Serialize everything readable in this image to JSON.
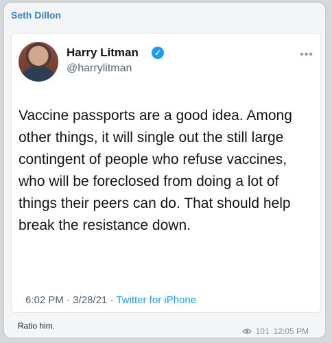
{
  "message": {
    "sender_name": "Seth Dillon",
    "caption": "Ratio him.",
    "views": "101",
    "time": "12:05 PM"
  },
  "tweet": {
    "author_name": "Harry Litman",
    "author_handle": "@harrylitman",
    "text": "Vaccine passports are a good idea. Among other things, it will single out the still large contingent of people who refuse vaccines, who will be foreclosed from doing a lot of things their peers can do.  That should help break the resistance down.",
    "time": "6:02 PM",
    "date": "3/28/21",
    "separator": "·",
    "source": "Twitter for iPhone",
    "verified_icon": "checkmark-icon",
    "more_icon": "more-icon"
  },
  "colors": {
    "sender": "#2f82c8",
    "link": "#1d9bf0",
    "verified": "#1d9bf0"
  }
}
